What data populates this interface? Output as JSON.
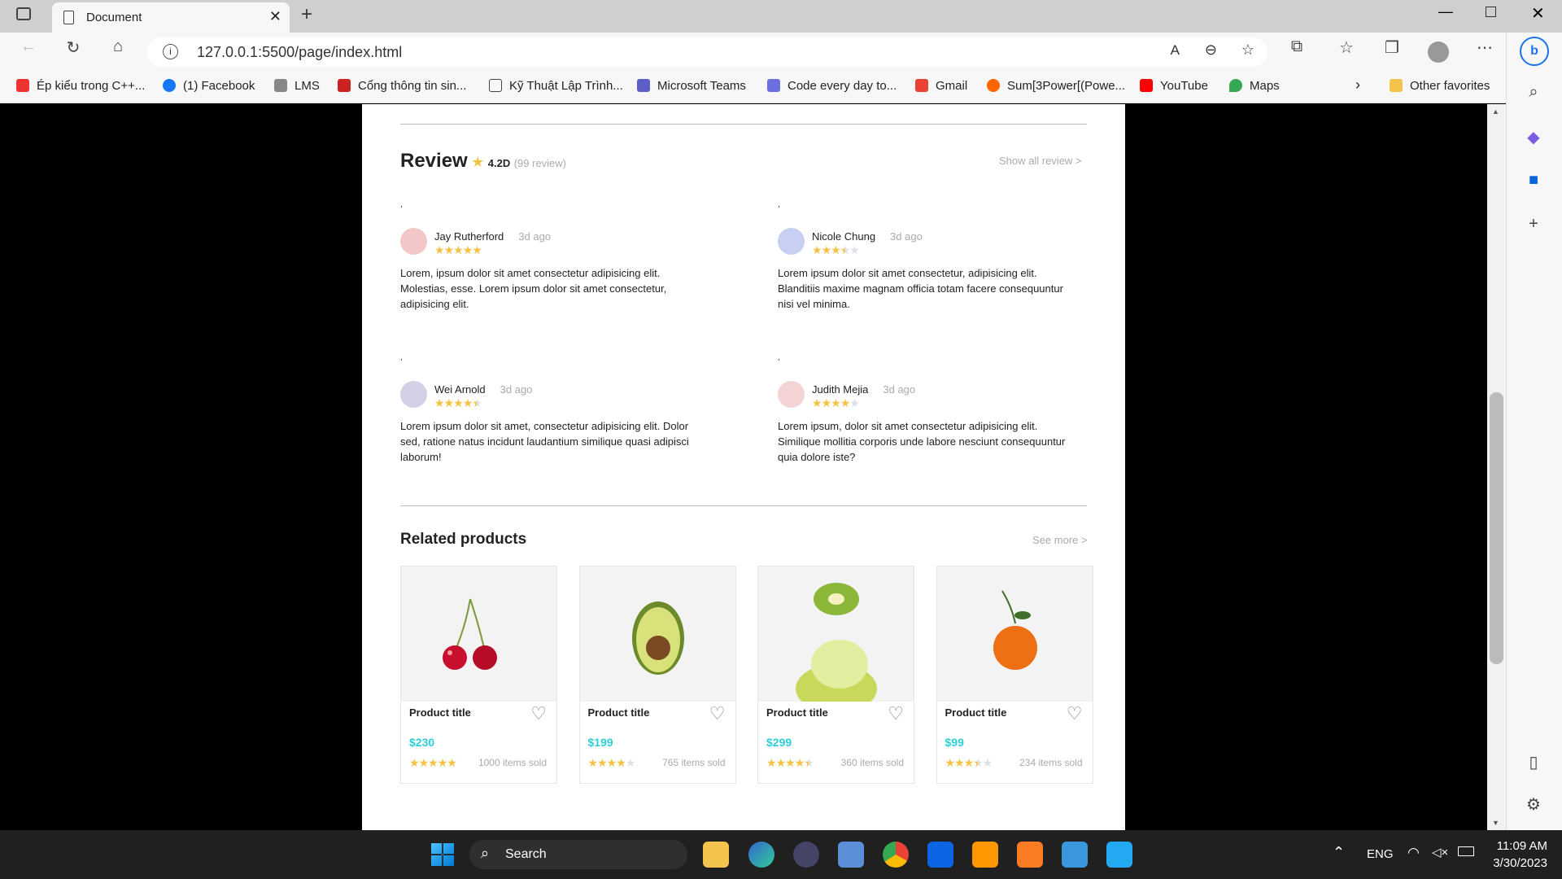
{
  "browser": {
    "tab_title": "Document",
    "url": "127.0.0.1:5500/page/index.html",
    "favorites": [
      "Ép kiểu trong C++...",
      "(1) Facebook",
      "LMS",
      "Cổng thông tin sin...",
      "Kỹ Thuật Lập Trình...",
      "Microsoft Teams",
      "Code every day to...",
      "Gmail",
      "Sum[3Power[(Powe...",
      "YouTube",
      "Maps"
    ],
    "other_favorites": "Other favorites"
  },
  "review": {
    "title": "Review",
    "rating": "4.2D",
    "count": "(99 review)",
    "show_all": "Show all review >",
    "items": [
      {
        "name": "Jay Rutherford",
        "ago": "3d ago",
        "stars": 5,
        "text": "Lorem, ipsum dolor sit amet consectetur adipisicing elit. Molestias, esse. Lorem ipsum dolor sit amet consectetur, adipisicing elit.",
        "dot": ","
      },
      {
        "name": "Nicole Chung",
        "ago": "3d ago",
        "stars": 3.5,
        "text": "Lorem ipsum dolor sit amet consectetur, adipisicing elit. Blanditiis maxime magnam officia totam facere consequuntur nisi vel minima.",
        "dot": ","
      },
      {
        "name": "Wei Arnold",
        "ago": "3d ago",
        "stars": 4.5,
        "text": "Lorem ipsum dolor sit amet, consectetur adipisicing elit. Dolor sed, ratione natus incidunt laudantium similique quasi adipisci laborum!",
        "dot": ","
      },
      {
        "name": "Judith Mejia",
        "ago": "3d ago",
        "stars": 4,
        "text": "Lorem ipsum, dolor sit amet consectetur adipisicing elit. Similique mollitia corporis unde labore nesciunt consequuntur quia dolore iste?",
        "dot": ","
      }
    ]
  },
  "related": {
    "title": "Related products",
    "see_more": "See more >",
    "products": [
      {
        "title": "Product title",
        "price": "$230",
        "stars": 5,
        "sold": "1000 items sold",
        "fruit": "cherry"
      },
      {
        "title": "Product title",
        "price": "$199",
        "stars": 4,
        "sold": "765 items sold",
        "fruit": "avocado"
      },
      {
        "title": "Product title",
        "price": "$299",
        "stars": 4.5,
        "sold": "360 items sold",
        "fruit": "kiwi-lime"
      },
      {
        "title": "Product title",
        "price": "$99",
        "stars": 3.5,
        "sold": "234 items sold",
        "fruit": "tangerine"
      }
    ]
  },
  "taskbar": {
    "search": "Search",
    "lang": "ENG",
    "time": "11:09 AM",
    "date": "3/30/2023"
  }
}
